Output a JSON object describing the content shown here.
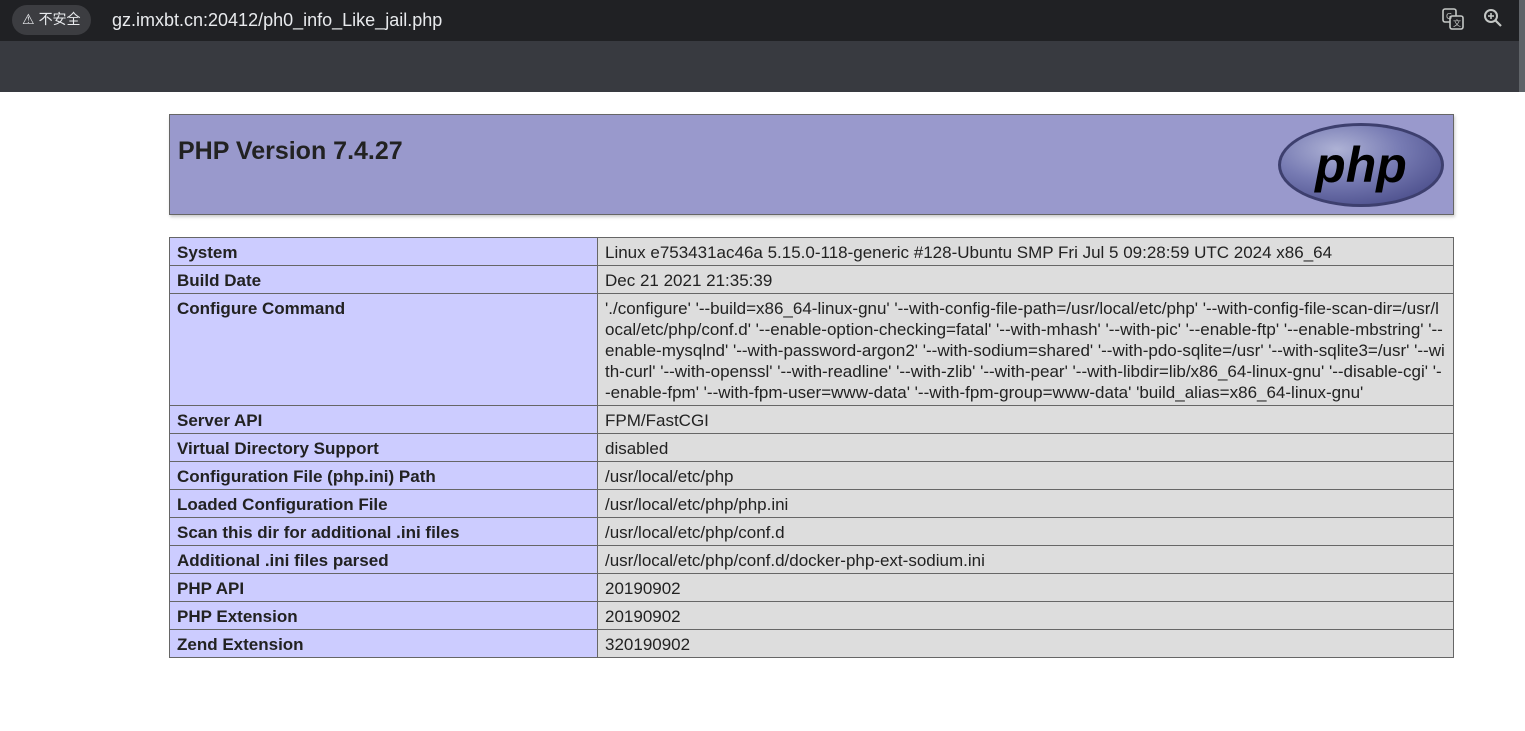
{
  "browser": {
    "security_label": "不安全",
    "url": "gz.imxbt.cn:20412/ph0_info_Like_jail.php"
  },
  "header": {
    "title": "PHP Version 7.4.27",
    "logo_text": "php"
  },
  "rows": [
    {
      "key": "System",
      "value": "Linux e753431ac46a 5.15.0-118-generic #128-Ubuntu SMP Fri Jul 5 09:28:59 UTC 2024 x86_64"
    },
    {
      "key": "Build Date",
      "value": "Dec 21 2021 21:35:39"
    },
    {
      "key": "Configure Command",
      "value": "'./configure' '--build=x86_64-linux-gnu' '--with-config-file-path=/usr/local/etc/php' '--with-config-file-scan-dir=/usr/local/etc/php/conf.d' '--enable-option-checking=fatal' '--with-mhash' '--with-pic' '--enable-ftp' '--enable-mbstring' '--enable-mysqlnd' '--with-password-argon2' '--with-sodium=shared' '--with-pdo-sqlite=/usr' '--with-sqlite3=/usr' '--with-curl' '--with-openssl' '--with-readline' '--with-zlib' '--with-pear' '--with-libdir=lib/x86_64-linux-gnu' '--disable-cgi' '--enable-fpm' '--with-fpm-user=www-data' '--with-fpm-group=www-data' 'build_alias=x86_64-linux-gnu'"
    },
    {
      "key": "Server API",
      "value": "FPM/FastCGI"
    },
    {
      "key": "Virtual Directory Support",
      "value": "disabled"
    },
    {
      "key": "Configuration File (php.ini) Path",
      "value": "/usr/local/etc/php"
    },
    {
      "key": "Loaded Configuration File",
      "value": "/usr/local/etc/php/php.ini"
    },
    {
      "key": "Scan this dir for additional .ini files",
      "value": "/usr/local/etc/php/conf.d"
    },
    {
      "key": "Additional .ini files parsed",
      "value": "/usr/local/etc/php/conf.d/docker-php-ext-sodium.ini"
    },
    {
      "key": "PHP API",
      "value": "20190902"
    },
    {
      "key": "PHP Extension",
      "value": "20190902"
    },
    {
      "key": "Zend Extension",
      "value": "320190902"
    }
  ],
  "icons": {
    "warning": "warning-triangle-icon",
    "translate": "translate-icon",
    "zoom": "zoom-in-icon"
  },
  "colors": {
    "header_bg": "#9999cc",
    "key_bg": "#ccccff",
    "value_bg": "#dddddd"
  }
}
